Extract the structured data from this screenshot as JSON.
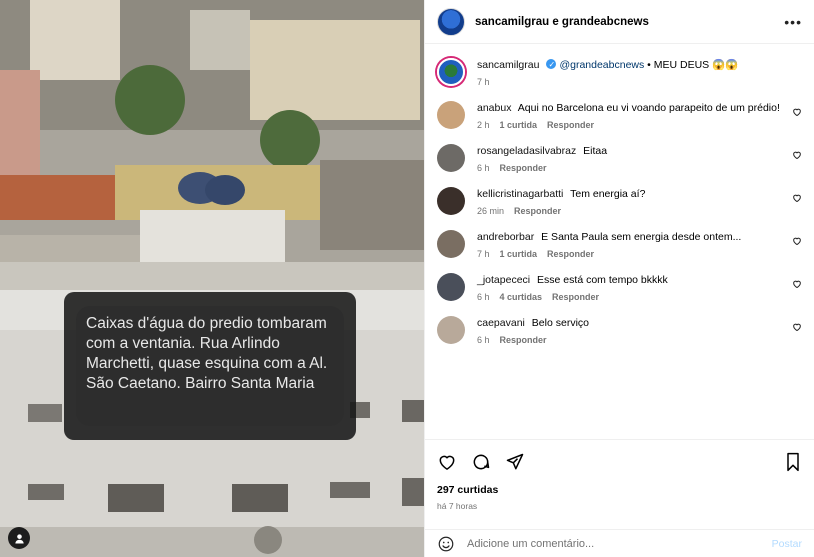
{
  "post": {
    "header_title": "sancamilgrau e grandeabcnews",
    "more_label": "•••",
    "caption": {
      "user": "sancamilgrau",
      "mention": "@grandeabcnews",
      "text": "• MEU DEUS 😱😱",
      "time": "7 h"
    },
    "overlay_text": "Caixas d'água do predio tombaram com a ventania. Rua Arlindo Marchetti, quase esquina com a Al. São Caetano. Bairro Santa Maria",
    "likes": "297 curtidas",
    "posted_ago": "há 7 horas",
    "add_comment_placeholder": "Adicione um comentário...",
    "post_label": "Postar"
  },
  "comments": [
    {
      "user": "anabux",
      "text": "Aqui no Barcelona eu vi voando parapeito de um prédio!",
      "time": "2 h",
      "likes": "1 curtida",
      "reply": "Responder",
      "avatar_color": "#c9a27a"
    },
    {
      "user": "rosangeladasilvabraz",
      "text": "Eitaa",
      "time": "6 h",
      "likes": "",
      "reply": "Responder",
      "avatar_color": "#6d6a66"
    },
    {
      "user": "kellicristinagarbatti",
      "text": "Tem energia aí?",
      "time": "26 min",
      "likes": "",
      "reply": "Responder",
      "avatar_color": "#3a2f2a"
    },
    {
      "user": "andreborbar",
      "text": "E Santa Paula sem energia desde ontem...",
      "time": "7 h",
      "likes": "1 curtida",
      "reply": "Responder",
      "avatar_color": "#7a6e62"
    },
    {
      "user": "_jotapececi",
      "text": "Esse está com tempo bkkkk",
      "time": "6 h",
      "likes": "4 curtidas",
      "reply": "Responder",
      "avatar_color": "#4a4f5a"
    },
    {
      "user": "caepavani",
      "text": "Belo serviço",
      "time": "6 h",
      "likes": "",
      "reply": "Responder",
      "avatar_color": "#b8a99a"
    }
  ],
  "icons": {
    "like": "heart-icon",
    "comment": "comment-icon",
    "share": "send-icon",
    "save": "bookmark-icon",
    "emoji": "emoji-icon",
    "media_user": "user-icon"
  }
}
